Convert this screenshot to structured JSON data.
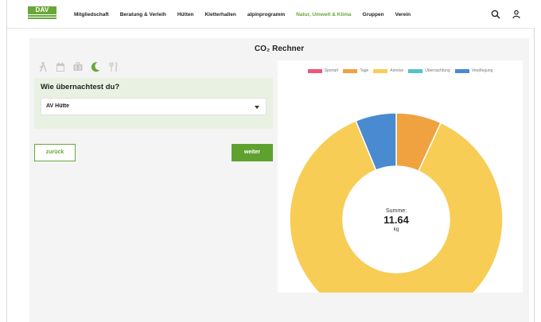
{
  "header": {
    "logo_text": "DAV",
    "nav_items": [
      "Mitgliedschaft",
      "Beratung & Verleih",
      "Hütten",
      "Kletterhallen",
      "alpinprogramm",
      "Natur, Umwelt & Klima",
      "Gruppen",
      "Verein"
    ],
    "active_index": 5,
    "icons": [
      "search-icon",
      "user-icon"
    ]
  },
  "calculator": {
    "title": "CO₂ Rechner",
    "step_icons": [
      "hiking-icon",
      "calendar-icon",
      "car-icon",
      "moon-icon",
      "fork-knife-icon"
    ],
    "active_step": 3,
    "question": "Wie übernachtest du?",
    "select_value": "AV Hütte",
    "back_label": "zurück",
    "next_label": "weiter"
  },
  "chart_data": {
    "type": "doughnut",
    "title": "",
    "legend": [
      "Sportart",
      "Tage",
      "Anreise",
      "Übernachtung",
      "Verpflegung"
    ],
    "colors": [
      "#f0567a",
      "#f0a140",
      "#f8cd56",
      "#54c2c8",
      "#4a8ad0"
    ],
    "values": [
      0,
      0.8,
      10.12,
      0,
      0.72
    ],
    "center": {
      "label": "Summe:",
      "value": "11.64",
      "unit": "kg"
    }
  },
  "colors": {
    "accent": "#6aa73a",
    "panel": "#f4f4f4"
  }
}
